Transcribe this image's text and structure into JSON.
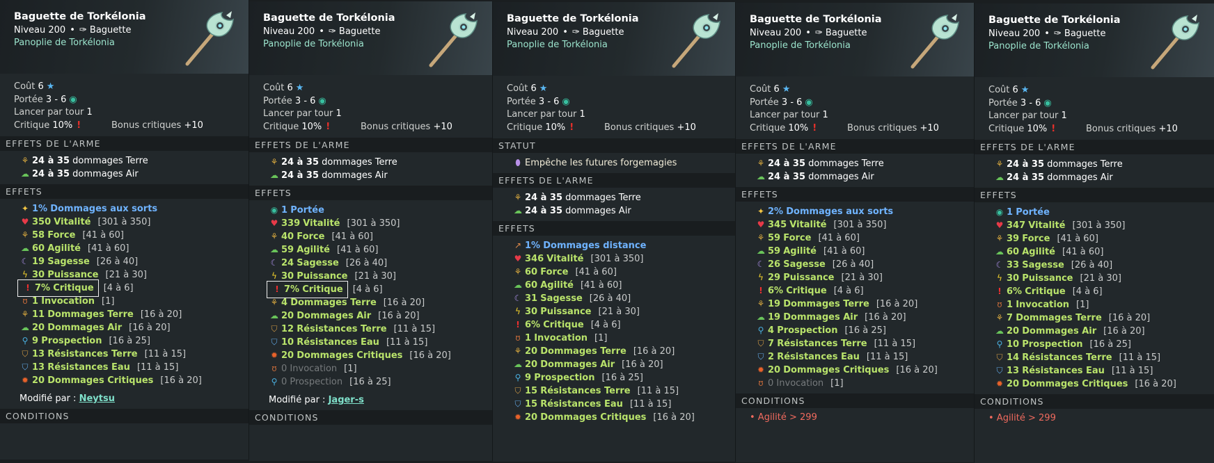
{
  "common": {
    "item_name": "Baguette de Torkélonia",
    "level_label": "Niveau 200",
    "type_label": "Baguette",
    "set_label": "Panoplie de Torkélonia",
    "cost_label": "Coût",
    "cost_value": "6",
    "range_label": "Portée",
    "range_value": "3 - 6",
    "casts_label": "Lancer par tour",
    "casts_value": "1",
    "crit_label": "Critique",
    "crit_value": "10%",
    "crit_bonus_label": "Bonus critiques",
    "crit_bonus_value": "+10",
    "sec_statut": "STATUT",
    "statut_text": "Empêche les futures forgemagies",
    "sec_weapon": "EFFETS DE L'ARME",
    "weapon_terre_num": "24 à 35",
    "weapon_terre_desc": "dommages Terre",
    "weapon_air_num": "24 à 35",
    "weapon_air_desc": "dommages Air",
    "sec_effects": "EFFETS",
    "sec_conditions": "CONDITIONS",
    "modified_label": "Modifié par :",
    "icon_colors": {
      "terre": "#d9a93f",
      "air": "#69c45a",
      "vitalite": "#e73a48",
      "critique": "#ee3030",
      "sagesse": "#a58be0",
      "puissance": "#f2d02a"
    }
  },
  "panels": [
    {
      "effects": [
        {
          "icon": "dommages-sorts-icon",
          "value": "1%",
          "label": "Dommages aux sorts",
          "range": "",
          "style": "b"
        },
        {
          "icon": "vitalite-icon",
          "value": "350",
          "label": "Vitalité",
          "range": "[301 à 350]",
          "style": "g"
        },
        {
          "icon": "force-icon",
          "value": "58",
          "label": "Force",
          "range": "[41 à 60]",
          "style": "g"
        },
        {
          "icon": "agilite-icon",
          "value": "60",
          "label": "Agilité",
          "range": "[41 à 60]",
          "style": "g"
        },
        {
          "icon": "sagesse-icon",
          "value": "19",
          "label": "Sagesse",
          "range": "[26 à 40]",
          "style": "g"
        },
        {
          "icon": "puissance-icon",
          "value": "30",
          "label": "Puissance",
          "range": "[21 à 30]",
          "style": "g"
        },
        {
          "icon": "critique-icon",
          "value": "7%",
          "label": "Critique",
          "range": "[4 à 6]",
          "style": "g",
          "boxed": true
        },
        {
          "icon": "invocation-icon",
          "value": "1",
          "label": "Invocation",
          "range": "[1]",
          "style": "g"
        },
        {
          "icon": "dommages-terre-icon",
          "value": "11",
          "label": "Dommages Terre",
          "range": "[16 à 20]",
          "style": "g"
        },
        {
          "icon": "dommages-air-icon",
          "value": "20",
          "label": "Dommages Air",
          "range": "[16 à 20]",
          "style": "g"
        },
        {
          "icon": "prospection-icon",
          "value": "9",
          "label": "Prospection",
          "range": "[16 à 25]",
          "style": "g"
        },
        {
          "icon": "resistance-terre-icon",
          "value": "13",
          "label": "Résistances Terre",
          "range": "[11 à 15]",
          "style": "g"
        },
        {
          "icon": "resistance-eau-icon",
          "value": "13",
          "label": "Résistances Eau",
          "range": "[11 à 15]",
          "style": "g"
        },
        {
          "icon": "dommages-critiques-icon",
          "value": "20",
          "label": "Dommages Critiques",
          "range": "[16 à 20]",
          "style": "g"
        }
      ],
      "modified_by": "Neytsu",
      "condition": ""
    },
    {
      "effects": [
        {
          "icon": "portee-icon",
          "value": "1",
          "label": "Portée",
          "range": "",
          "style": "b"
        },
        {
          "icon": "vitalite-icon",
          "value": "339",
          "label": "Vitalité",
          "range": "[301 à 350]",
          "style": "g"
        },
        {
          "icon": "force-icon",
          "value": "40",
          "label": "Force",
          "range": "[41 à 60]",
          "style": "g"
        },
        {
          "icon": "agilite-icon",
          "value": "59",
          "label": "Agilité",
          "range": "[41 à 60]",
          "style": "g"
        },
        {
          "icon": "sagesse-icon",
          "value": "24",
          "label": "Sagesse",
          "range": "[26 à 40]",
          "style": "g"
        },
        {
          "icon": "puissance-icon",
          "value": "30",
          "label": "Puissance",
          "range": "[21 à 30]",
          "style": "g"
        },
        {
          "icon": "critique-icon",
          "value": "7%",
          "label": "Critique",
          "range": "[4 à 6]",
          "style": "g",
          "boxed": true
        },
        {
          "icon": "dommages-terre-icon",
          "value": "4",
          "label": "Dommages Terre",
          "range": "[16 à 20]",
          "style": "g"
        },
        {
          "icon": "dommages-air-icon",
          "value": "20",
          "label": "Dommages Air",
          "range": "[16 à 20]",
          "style": "g"
        },
        {
          "icon": "resistance-terre-icon",
          "value": "12",
          "label": "Résistances Terre",
          "range": "[11 à 15]",
          "style": "g"
        },
        {
          "icon": "resistance-eau-icon",
          "value": "10",
          "label": "Résistances Eau",
          "range": "[11 à 15]",
          "style": "g"
        },
        {
          "icon": "dommages-critiques-icon",
          "value": "20",
          "label": "Dommages Critiques",
          "range": "[16 à 20]",
          "style": "g"
        },
        {
          "icon": "invocation-icon",
          "value": "0",
          "label": "Invocation",
          "range": "[1]",
          "style": "x"
        },
        {
          "icon": "prospection-icon",
          "value": "0",
          "label": "Prospection",
          "range": "[16 à 25]",
          "style": "x"
        }
      ],
      "modified_by": "Jager-s",
      "condition": ""
    },
    {
      "effects": [
        {
          "icon": "dommages-distance-icon",
          "value": "1%",
          "label": "Dommages distance",
          "range": "",
          "style": "b"
        },
        {
          "icon": "vitalite-icon",
          "value": "346",
          "label": "Vitalité",
          "range": "[301 à 350]",
          "style": "g"
        },
        {
          "icon": "force-icon",
          "value": "60",
          "label": "Force",
          "range": "[41 à 60]",
          "style": "g"
        },
        {
          "icon": "agilite-icon",
          "value": "60",
          "label": "Agilité",
          "range": "[41 à 60]",
          "style": "g"
        },
        {
          "icon": "sagesse-icon",
          "value": "31",
          "label": "Sagesse",
          "range": "[26 à 40]",
          "style": "g"
        },
        {
          "icon": "puissance-icon",
          "value": "30",
          "label": "Puissance",
          "range": "[21 à 30]",
          "style": "g"
        },
        {
          "icon": "critique-icon",
          "value": "6%",
          "label": "Critique",
          "range": "[4 à 6]",
          "style": "g"
        },
        {
          "icon": "invocation-icon",
          "value": "1",
          "label": "Invocation",
          "range": "[1]",
          "style": "g"
        },
        {
          "icon": "dommages-terre-icon",
          "value": "20",
          "label": "Dommages Terre",
          "range": "[16 à 20]",
          "style": "g"
        },
        {
          "icon": "dommages-air-icon",
          "value": "20",
          "label": "Dommages Air",
          "range": "[16 à 20]",
          "style": "g"
        },
        {
          "icon": "prospection-icon",
          "value": "9",
          "label": "Prospection",
          "range": "[16 à 25]",
          "style": "g"
        },
        {
          "icon": "resistance-terre-icon",
          "value": "15",
          "label": "Résistances Terre",
          "range": "[11 à 15]",
          "style": "g"
        },
        {
          "icon": "resistance-eau-icon",
          "value": "15",
          "label": "Résistances Eau",
          "range": "[11 à 15]",
          "style": "g"
        },
        {
          "icon": "dommages-critiques-icon",
          "value": "20",
          "label": "Dommages Critiques",
          "range": "[16 à 20]",
          "style": "g"
        }
      ],
      "modified_by": "",
      "condition": ""
    },
    {
      "effects": [
        {
          "icon": "dommages-sorts-icon",
          "value": "2%",
          "label": "Dommages aux sorts",
          "range": "",
          "style": "b"
        },
        {
          "icon": "vitalite-icon",
          "value": "345",
          "label": "Vitalité",
          "range": "[301 à 350]",
          "style": "g"
        },
        {
          "icon": "force-icon",
          "value": "59",
          "label": "Force",
          "range": "[41 à 60]",
          "style": "g"
        },
        {
          "icon": "agilite-icon",
          "value": "59",
          "label": "Agilité",
          "range": "[41 à 60]",
          "style": "g"
        },
        {
          "icon": "sagesse-icon",
          "value": "26",
          "label": "Sagesse",
          "range": "[26 à 40]",
          "style": "g"
        },
        {
          "icon": "puissance-icon",
          "value": "29",
          "label": "Puissance",
          "range": "[21 à 30]",
          "style": "g"
        },
        {
          "icon": "critique-icon",
          "value": "6%",
          "label": "Critique",
          "range": "[4 à 6]",
          "style": "g"
        },
        {
          "icon": "dommages-terre-icon",
          "value": "19",
          "label": "Dommages Terre",
          "range": "[16 à 20]",
          "style": "g"
        },
        {
          "icon": "dommages-air-icon",
          "value": "19",
          "label": "Dommages Air",
          "range": "[16 à 20]",
          "style": "g"
        },
        {
          "icon": "prospection-icon",
          "value": "4",
          "label": "Prospection",
          "range": "[16 à 25]",
          "style": "g"
        },
        {
          "icon": "resistance-terre-icon",
          "value": "7",
          "label": "Résistances Terre",
          "range": "[11 à 15]",
          "style": "g"
        },
        {
          "icon": "resistance-eau-icon",
          "value": "2",
          "label": "Résistances Eau",
          "range": "[11 à 15]",
          "style": "g"
        },
        {
          "icon": "dommages-critiques-icon",
          "value": "20",
          "label": "Dommages Critiques",
          "range": "[16 à 20]",
          "style": "g"
        },
        {
          "icon": "invocation-icon",
          "value": "0",
          "label": "Invocation",
          "range": "[1]",
          "style": "x"
        }
      ],
      "modified_by": "",
      "condition": "• Agilité > 299"
    },
    {
      "effects": [
        {
          "icon": "portee-icon",
          "value": "1",
          "label": "Portée",
          "range": "",
          "style": "b"
        },
        {
          "icon": "vitalite-icon",
          "value": "347",
          "label": "Vitalité",
          "range": "[301 à 350]",
          "style": "g"
        },
        {
          "icon": "force-icon",
          "value": "39",
          "label": "Force",
          "range": "[41 à 60]",
          "style": "g"
        },
        {
          "icon": "agilite-icon",
          "value": "60",
          "label": "Agilité",
          "range": "[41 à 60]",
          "style": "g"
        },
        {
          "icon": "sagesse-icon",
          "value": "33",
          "label": "Sagesse",
          "range": "[26 à 40]",
          "style": "g"
        },
        {
          "icon": "puissance-icon",
          "value": "30",
          "label": "Puissance",
          "range": "[21 à 30]",
          "style": "g"
        },
        {
          "icon": "critique-icon",
          "value": "6%",
          "label": "Critique",
          "range": "[4 à 6]",
          "style": "g"
        },
        {
          "icon": "invocation-icon",
          "value": "1",
          "label": "Invocation",
          "range": "[1]",
          "style": "g"
        },
        {
          "icon": "dommages-terre-icon",
          "value": "7",
          "label": "Dommages Terre",
          "range": "[16 à 20]",
          "style": "g"
        },
        {
          "icon": "dommages-air-icon",
          "value": "20",
          "label": "Dommages Air",
          "range": "[16 à 20]",
          "style": "g"
        },
        {
          "icon": "prospection-icon",
          "value": "10",
          "label": "Prospection",
          "range": "[16 à 25]",
          "style": "g"
        },
        {
          "icon": "resistance-terre-icon",
          "value": "14",
          "label": "Résistances Terre",
          "range": "[11 à 15]",
          "style": "g"
        },
        {
          "icon": "resistance-eau-icon",
          "value": "13",
          "label": "Résistances Eau",
          "range": "[11 à 15]",
          "style": "g"
        },
        {
          "icon": "dommages-critiques-icon",
          "value": "20",
          "label": "Dommages Critiques",
          "range": "[16 à 20]",
          "style": "g"
        }
      ],
      "modified_by": "",
      "condition": "• Agilité > 299"
    }
  ]
}
